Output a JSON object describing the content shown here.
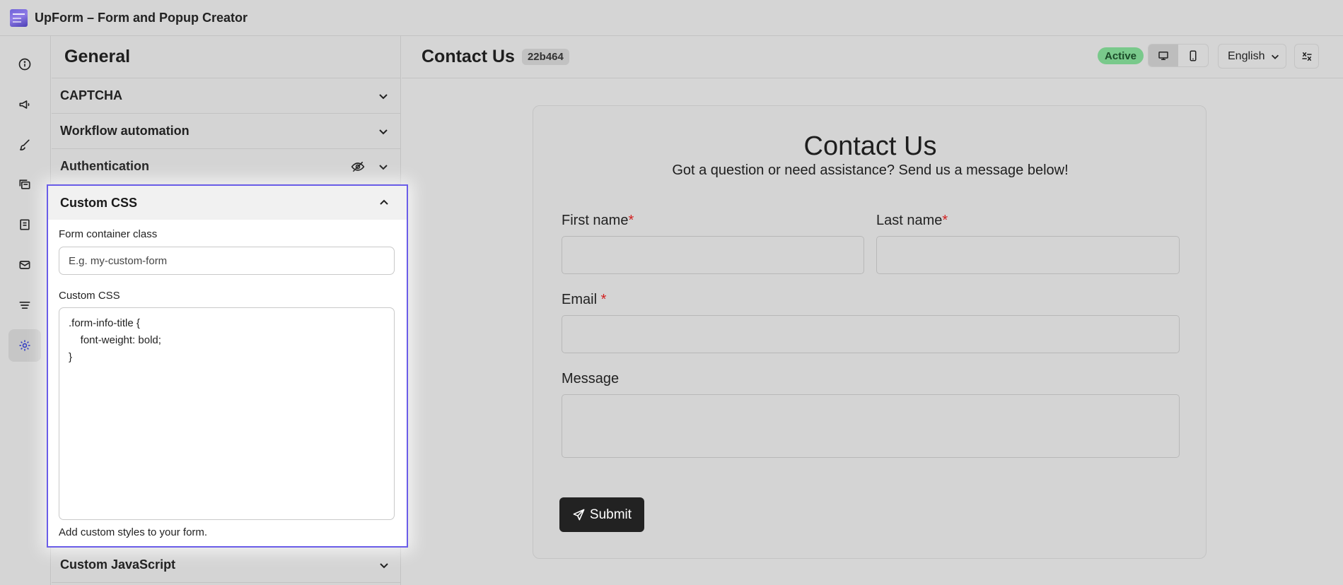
{
  "app": {
    "title": "UpForm – Form and Popup Creator"
  },
  "rail": {
    "items": [
      {
        "icon": "info-icon"
      },
      {
        "icon": "megaphone-icon"
      },
      {
        "icon": "brush-icon"
      },
      {
        "icon": "layers-icon"
      },
      {
        "icon": "entries-icon"
      },
      {
        "icon": "mail-icon"
      },
      {
        "icon": "filter-icon"
      },
      {
        "icon": "gear-icon",
        "active": true
      }
    ]
  },
  "panel": {
    "title": "General",
    "sections": {
      "captcha": "CAPTCHA",
      "workflow": "Workflow automation",
      "auth": "Authentication",
      "custom_css": "Custom CSS",
      "custom_js": "Custom JavaScript"
    },
    "custom_css_section": {
      "container_label": "Form container class",
      "container_placeholder": "E.g. my-custom-form",
      "css_label": "Custom CSS",
      "css_value": ".form-info-title {\n    font-weight: bold;\n}",
      "help": "Add custom styles to your form."
    }
  },
  "header": {
    "form_title": "Contact Us",
    "form_id": "22b464",
    "status": "Active",
    "language": "English"
  },
  "preview": {
    "title": "Contact Us",
    "subtitle": "Got a question or need assistance? Send us a message below!",
    "first_name": "First name",
    "last_name": "Last name",
    "email": "Email",
    "message": "Message",
    "required_mark": "*",
    "submit": "Submit"
  },
  "colors": {
    "accent": "#6a5de8",
    "active_badge": "#79c98b",
    "required": "#d21f1f"
  }
}
